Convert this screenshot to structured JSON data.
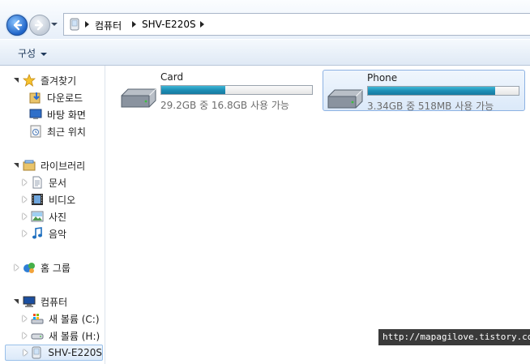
{
  "address": {
    "crumbs": [
      "컴퓨터",
      "SHV-E220S"
    ]
  },
  "toolbar": {
    "organize_label": "구성"
  },
  "nav": {
    "favorites": {
      "label": "즐겨찾기",
      "items": [
        "다운로드",
        "바탕 화면",
        "최근 위치"
      ]
    },
    "libraries": {
      "label": "라이브러리",
      "items": [
        "문서",
        "비디오",
        "사진",
        "음악"
      ]
    },
    "homegroup": {
      "label": "홈 그룹"
    },
    "computer": {
      "label": "컴퓨터",
      "items": [
        "새 볼륨 (C:)",
        "새 볼륨 (H:)",
        "SHV-E220S"
      ]
    }
  },
  "drives": [
    {
      "name": "Card",
      "info": "29.2GB 중 16.8GB 사용 가능",
      "used_fraction": 0.425,
      "selected": false
    },
    {
      "name": "Phone",
      "info": "3.34GB 중 518MB 사용 가능",
      "used_fraction": 0.845,
      "selected": true
    }
  ],
  "watermark": "http://mapagilove.tistory.com",
  "colors": {
    "bar_fill": "#1e8fb6",
    "selection_border": "#8db2e3"
  }
}
